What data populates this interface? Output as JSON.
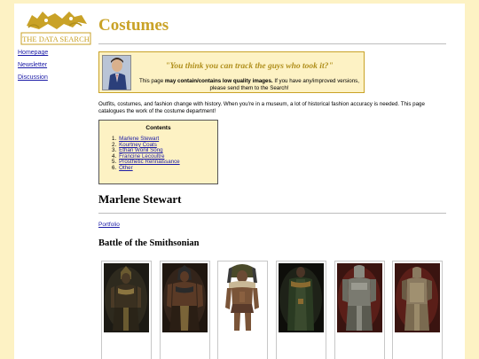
{
  "logo": {
    "text": "THE DATA SEARCH"
  },
  "sidebar": {
    "links": [
      {
        "label": "Homepage"
      },
      {
        "label": "Newsletter"
      },
      {
        "label": "Discussion"
      }
    ]
  },
  "main": {
    "title": "Costumes",
    "notice": {
      "quote": "\"You think you can track the guys who took it?\"",
      "text_before": "This page ",
      "text_bold": "may contain/contains low quality images.",
      "text_after": " If you have any/improved versions, please send them to the Search!"
    },
    "intro": "Outfits, costumes, and fashion change with history. When you're in a museum, a lot of historical fashion accuracy is needed. This page catalogues the work of the costume department!",
    "toc": {
      "title": "Contents",
      "items": [
        {
          "num": "1.",
          "label": "Marlene Stewart"
        },
        {
          "num": "2.",
          "label": "Kourtney Coats"
        },
        {
          "num": "3.",
          "label": "Ethan Wonil Song"
        },
        {
          "num": "4.",
          "label": "Francine Lecoultre"
        },
        {
          "num": "5.",
          "label": "Prosthetic Rennaissance"
        },
        {
          "num": "6.",
          "label": "Other"
        }
      ]
    },
    "section_heading": "Marlene Stewart",
    "portfolio_link": "Portfolio",
    "subsection_heading": "Battle of the Smithsonian"
  },
  "colors": {
    "page_bg": "#fdf2c4",
    "gold": "#c9a227",
    "link": "#1a1aa6"
  }
}
